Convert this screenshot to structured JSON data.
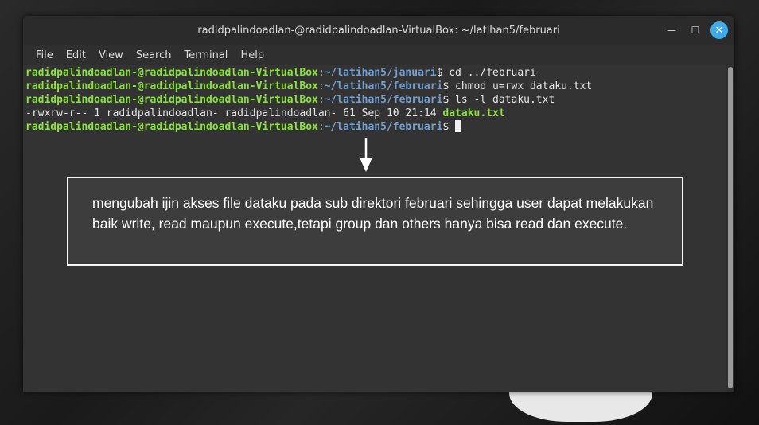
{
  "window": {
    "title": "radidpalindoadlan-@radidpalindoadlan-VirtualBox: ~/latihan5/februari",
    "controls": {
      "minimize": "—",
      "maximize": "☐",
      "close": "✕"
    }
  },
  "menu": [
    "File",
    "Edit",
    "View",
    "Search",
    "Terminal",
    "Help"
  ],
  "terminal": {
    "lines": [
      {
        "user": "radidpalindoadlan-@radidpalindoadlan-VirtualBox",
        "sep": ":",
        "path": "~/latihan5/januari",
        "prompt": "$",
        "cmd": " cd ../februari"
      },
      {
        "user": "radidpalindoadlan-@radidpalindoadlan-VirtualBox",
        "sep": ":",
        "path": "~/latihan5/februari",
        "prompt": "$",
        "cmd": " chmod u=rwx dataku.txt"
      },
      {
        "user": "radidpalindoadlan-@radidpalindoadlan-VirtualBox",
        "sep": ":",
        "path": "~/latihan5/februari",
        "prompt": "$",
        "cmd": " ls -l dataku.txt"
      }
    ],
    "ls_output": {
      "prefix": "-rwxrw-r-- 1 radidpalindoadlan- radidpalindoadlan- 61 Sep 10 21:14 ",
      "file": "dataku.txt"
    },
    "last_prompt": {
      "user": "radidpalindoadlan-@radidpalindoadlan-VirtualBox",
      "sep": ":",
      "path": "~/latihan5/februari",
      "prompt": "$ "
    }
  },
  "annotation": {
    "text": "mengubah ijin akses file dataku pada sub direktori februari sehingga user dapat melakukan baik write, read maupun execute,tetapi group dan others hanya bisa read dan execute."
  },
  "colors": {
    "user": "#8ae234",
    "path": "#729fcf",
    "close_button": "#3daee9"
  }
}
